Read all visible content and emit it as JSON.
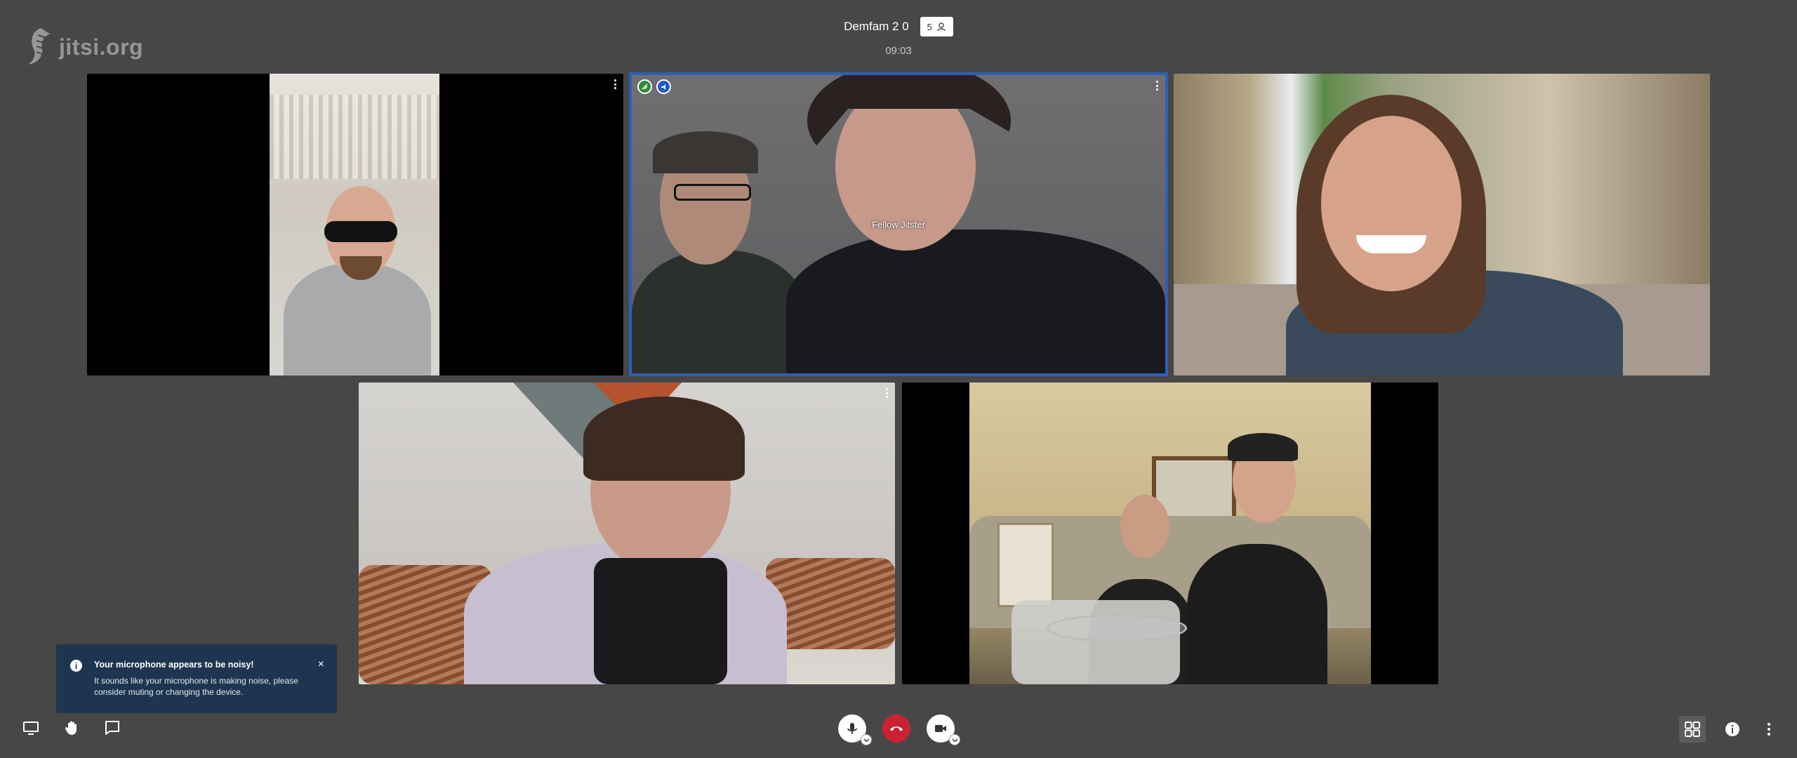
{
  "header": {
    "meeting_title": "Demfam 2 0",
    "participant_count": "5",
    "timer": "09:03"
  },
  "watermark": {
    "text": "jitsi.org"
  },
  "tiles": [
    {
      "name": "",
      "active": false
    },
    {
      "name": "Fellow Jitster",
      "active": true
    },
    {
      "name": "",
      "active": false
    },
    {
      "name": "",
      "active": false
    },
    {
      "name": "",
      "active": false
    }
  ],
  "notification": {
    "title": "Your microphone appears to be noisy!",
    "body": "It sounds like your microphone is making noise, please consider muting or changing the device.",
    "close_icon": "×"
  },
  "icons": {
    "share_screen": "desktop-icon",
    "raise_hand": "hand-icon",
    "chat": "chat-icon",
    "microphone": "microphone-icon",
    "hangup": "phone-icon",
    "camera": "camera-icon",
    "tile_view": "grid-icon",
    "info": "info-icon",
    "more": "more-vertical-icon"
  },
  "colors": {
    "background": "#474747",
    "active_tile_border": "#2e5fb8",
    "hangup": "#cb2233",
    "notification_bg": "#1d3550"
  }
}
